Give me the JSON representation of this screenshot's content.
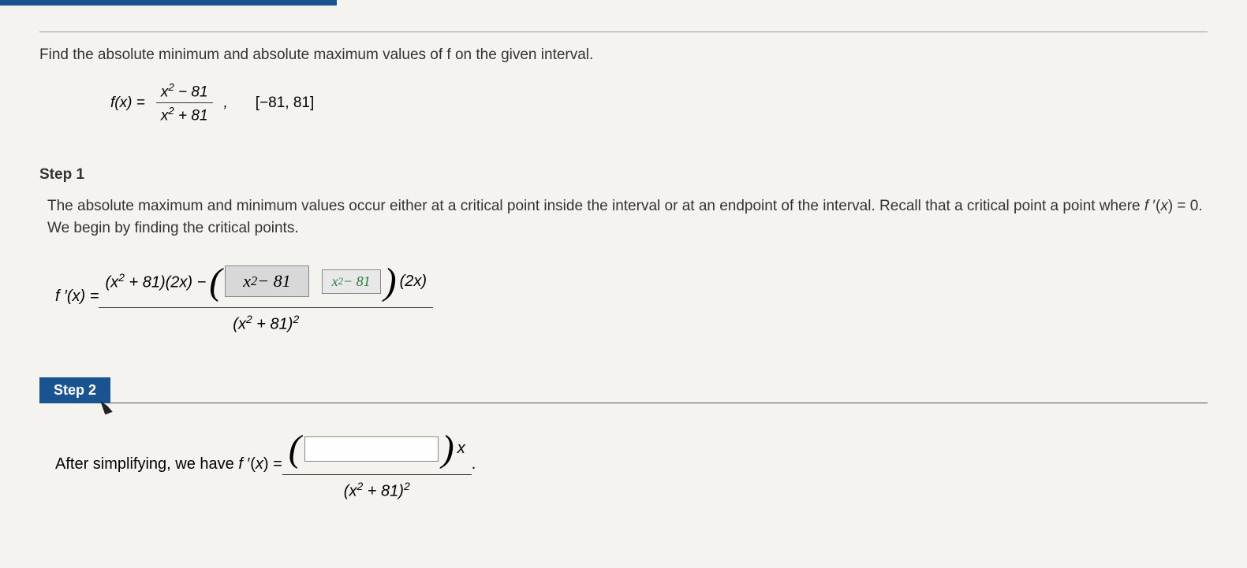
{
  "problem": {
    "statement": "Find the absolute minimum and absolute maximum values of f on the given interval.",
    "function_lhs": "f(x) =",
    "function_num": "x² − 81",
    "function_den": "x² + 81",
    "interval": "[−81, 81]"
  },
  "step1": {
    "label": "Step 1",
    "text": "The absolute maximum and minimum values occur either at a critical point inside the interval or at an endpoint of the interval. Recall that a critical point a point where f ′(x) = 0. We begin by finding the critical points.",
    "deriv_lhs": "f ′(x) =",
    "num_part1": "(x² + 81)(2x) −",
    "answer_box": "x² − 81",
    "answer_green": "x² − 81",
    "num_part2": "(2x)",
    "denominator": "(x² + 81)²"
  },
  "step2": {
    "label": "Step 2",
    "text_before": "After simplifying, we have f ′(x) =",
    "num_suffix": "x",
    "denominator": "(x² + 81)²",
    "tail": "."
  }
}
